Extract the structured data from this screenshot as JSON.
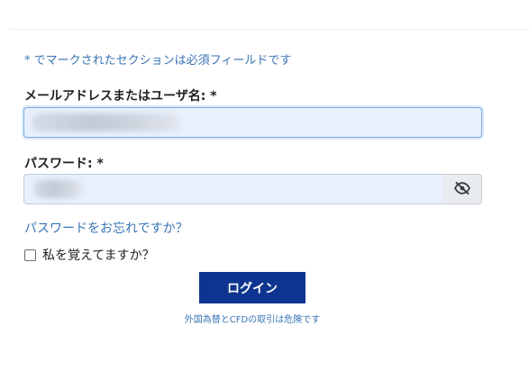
{
  "form": {
    "required_note": "* でマークされたセクションは必須フィールドです",
    "username_label": "メールアドレスまたはユーザ名: *",
    "password_label": "パスワード: *",
    "forgot_password_link": "パスワードをお忘れですか？",
    "remember_me_label": "私を覚えてますか？",
    "remember_me_checked": false,
    "login_button": "ログイン",
    "risk_notice": "外国為替とCFDの取引は危険です"
  },
  "icons": {
    "password_toggle": "eye-slash-icon"
  }
}
